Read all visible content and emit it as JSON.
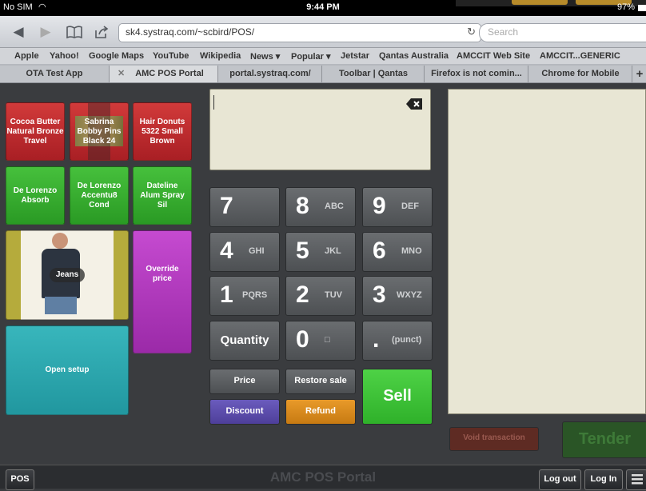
{
  "status_bar": {
    "carrier": "No SIM",
    "time": "9:44 PM",
    "battery": "97%"
  },
  "browser": {
    "url": "sk4.systraq.com/~scbird/POS/",
    "search_placeholder": "Search",
    "bookmarks": [
      "Apple",
      "Yahoo!",
      "Google Maps",
      "YouTube",
      "Wikipedia",
      "News ▾",
      "Popular ▾",
      "Jetstar",
      "Qantas Australia",
      "AMCCIT Web Site",
      "AMCCIT...GENERIC"
    ],
    "tabs": [
      "OTA Test App",
      "AMC POS Portal",
      "portal.systraq.com/",
      "Toolbar | Qantas",
      "Firefox is not comin...",
      "Chrome for Mobile"
    ],
    "new_tab": "+"
  },
  "items": {
    "cocoa": "Cocoa Butter Natural Bronze Travel",
    "sabrina": "Sabrina Bobby Pins Black 24",
    "hair_donuts": "Hair Donuts 5322 Small Brown",
    "de_lorenzo_absorb": "De Lorenzo Absorb",
    "de_lorenzo_accentu8": "De Lorenzo Accentu8 Cond",
    "dateline": "Dateline Alum Spray Sil",
    "jeans": "Jeans",
    "override": "Override price",
    "open_setup": "Open setup"
  },
  "keypad": {
    "k7": {
      "d": "7",
      "s": ""
    },
    "k8": {
      "d": "8",
      "s": "ABC"
    },
    "k9": {
      "d": "9",
      "s": "DEF"
    },
    "k4": {
      "d": "4",
      "s": "GHI"
    },
    "k5": {
      "d": "5",
      "s": "JKL"
    },
    "k6": {
      "d": "6",
      "s": "MNO"
    },
    "k1": {
      "d": "1",
      "s": "PQRS"
    },
    "k2": {
      "d": "2",
      "s": "TUV"
    },
    "k3": {
      "d": "3",
      "s": "WXYZ"
    },
    "quantity": "Quantity",
    "k0": {
      "d": "0",
      "s": "□"
    },
    "kdot": {
      "d": ".",
      "s": "(punct)"
    }
  },
  "actions": {
    "price": "Price",
    "restore_sale": "Restore sale",
    "discount": "Discount",
    "refund": "Refund",
    "sell": "Sell",
    "void": "Void transaction",
    "tender": "Tender"
  },
  "footer": {
    "pos": "POS",
    "title": "AMC POS Portal",
    "logout": "Log out",
    "login": "Log In"
  },
  "colors": {
    "red": "#b8262b",
    "green": "#34ad2d",
    "purple": "#b03bbd",
    "teal": "#2aa7ad",
    "sell": "#3cc936",
    "discount": "#5b4aa8",
    "refund": "#d98a1f",
    "panel": "#e8e6d4"
  }
}
